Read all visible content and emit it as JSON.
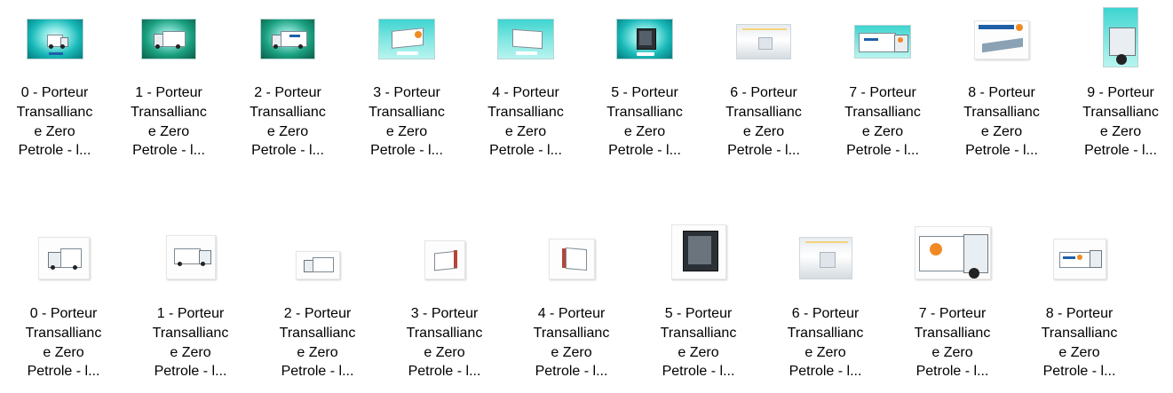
{
  "explorer": {
    "rows": [
      {
        "items": [
          {
            "label": "0 - Porteur\nTransallianc\ne Zero\nPetrole - l...",
            "icon": "image-thumbnail-icon"
          },
          {
            "label": "1 - Porteur\nTransallianc\ne Zero\nPetrole - l...",
            "icon": "image-thumbnail-icon"
          },
          {
            "label": "2 - Porteur\nTransallianc\ne Zero\nPetrole - l...",
            "icon": "image-thumbnail-icon"
          },
          {
            "label": "3 - Porteur\nTransallianc\ne Zero\nPetrole - l...",
            "icon": "image-thumbnail-icon"
          },
          {
            "label": "4 - Porteur\nTransallianc\ne Zero\nPetrole - l...",
            "icon": "image-thumbnail-icon"
          },
          {
            "label": "5 - Porteur\nTransallianc\ne Zero\nPetrole - l...",
            "icon": "image-thumbnail-icon"
          },
          {
            "label": "6 - Porteur\nTransallianc\ne Zero\nPetrole - l...",
            "icon": "image-thumbnail-icon"
          },
          {
            "label": "7 - Porteur\nTransallianc\ne Zero\nPetrole - l...",
            "icon": "image-thumbnail-icon"
          },
          {
            "label": "8 - Porteur\nTransallianc\ne Zero\nPetrole - l...",
            "icon": "image-thumbnail-icon"
          },
          {
            "label": "9 - Porteur\nTransallianc\ne Zero\nPetrole - l...",
            "icon": "image-thumbnail-icon"
          }
        ]
      },
      {
        "items": [
          {
            "label": "0 - Porteur\nTransallianc\ne Zero\nPetrole - l...",
            "icon": "image-thumbnail-icon"
          },
          {
            "label": "1 - Porteur\nTransallianc\ne Zero\nPetrole - l...",
            "icon": "image-thumbnail-icon"
          },
          {
            "label": "2 - Porteur\nTransallianc\ne Zero\nPetrole - l...",
            "icon": "image-thumbnail-icon"
          },
          {
            "label": "3 - Porteur\nTransallianc\ne Zero\nPetrole - l...",
            "icon": "image-thumbnail-icon"
          },
          {
            "label": "4 - Porteur\nTransallianc\ne Zero\nPetrole - l...",
            "icon": "image-thumbnail-icon"
          },
          {
            "label": "5 - Porteur\nTransallianc\ne Zero\nPetrole - l...",
            "icon": "image-thumbnail-icon"
          },
          {
            "label": "6 - Porteur\nTransallianc\ne Zero\nPetrole - l...",
            "icon": "image-thumbnail-icon"
          },
          {
            "label": "7 - Porteur\nTransallianc\ne Zero\nPetrole - l...",
            "icon": "image-thumbnail-icon"
          },
          {
            "label": "8 - Porteur\nTransallianc\ne Zero\nPetrole - l...",
            "icon": "image-thumbnail-icon"
          }
        ]
      }
    ],
    "colors": {
      "poster_teal": "#19b8b8",
      "brand_orange": "#f08a24",
      "brand_blue": "#1f5fa8",
      "background": "#ffffff"
    }
  }
}
